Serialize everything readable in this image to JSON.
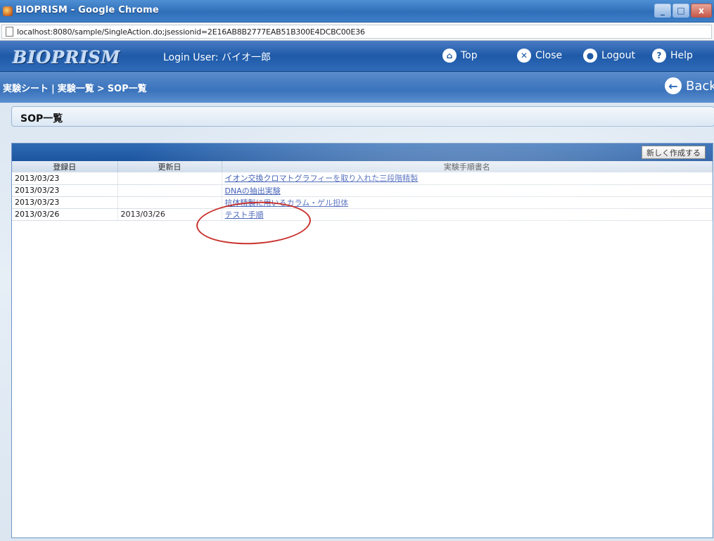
{
  "window": {
    "title": "BIOPRISM - Google Chrome",
    "controls": [
      "_",
      "□",
      "x"
    ]
  },
  "browser": {
    "url": "localhost:8080/sample/SingleAction.do;jsessionid=2E16AB8B2777EAB51B300E4DCBC00E36"
  },
  "app": {
    "logo": "BIOPRISM",
    "login_user_label": "Login User: バイオ一郎",
    "nav": {
      "top": "Top",
      "close": "Close",
      "logout": "Logout",
      "help": "Help"
    },
    "breadcrumb": [
      "実験シート",
      "実験一覧",
      "SOP一覧"
    ],
    "back": "Back"
  },
  "page": {
    "section_title": "SOP一覧",
    "new_button": "新しく作成する",
    "table": {
      "headers": [
        "登録日",
        "更新日",
        "実験手順書名"
      ],
      "rows": [
        {
          "registered": "2013/03/23",
          "updated": "",
          "name": "イオン交換クロマトグラフィーを取り入れた三段階精製"
        },
        {
          "registered": "2013/03/23",
          "updated": "",
          "name": "DNAの抽出実験"
        },
        {
          "registered": "2013/03/23",
          "updated": "",
          "name": "抗体精製に用いるカラム・ゲル担体"
        },
        {
          "registered": "2013/03/26",
          "updated": "2013/03/26",
          "name": "テスト手順"
        }
      ]
    }
  },
  "icons": {
    "top": "home-icon",
    "close": "close-circle-icon",
    "logout": "logout-icon",
    "help": "help-icon",
    "back": "back-arrow-icon"
  },
  "colors": {
    "header_blue": "#1e5aa8",
    "link": "#1a3fa8",
    "annotation_circle": "#c9302c"
  }
}
